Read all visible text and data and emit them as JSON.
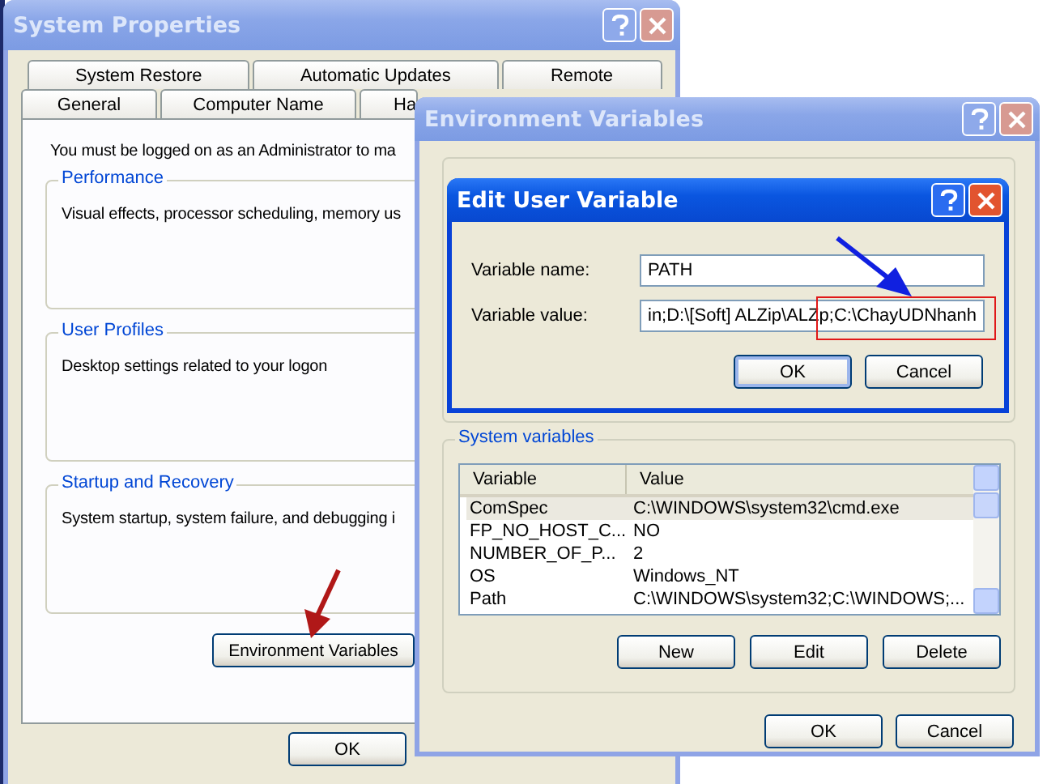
{
  "system_properties": {
    "title": "System Properties",
    "tab_rows": [
      [
        {
          "label": "System Restore"
        },
        {
          "label": "Automatic Updates"
        },
        {
          "label": "Remote"
        }
      ],
      [
        {
          "label": "General"
        },
        {
          "label": "Computer Name"
        },
        {
          "label": "Ha"
        }
      ]
    ],
    "notice": "You must be logged on as an Administrator to ma",
    "groups": [
      {
        "title": "Performance",
        "text": "Visual effects, processor scheduling, memory us"
      },
      {
        "title": "User Profiles",
        "text": "Desktop settings related to your logon"
      },
      {
        "title": "Startup and Recovery",
        "text": "System startup, system failure, and debugging i"
      }
    ],
    "environment_button": "Environment Variables",
    "ok_button": "OK"
  },
  "environment_variables": {
    "title": "Environment Variables",
    "system_variables": {
      "title": "System variables",
      "columns": [
        "Variable",
        "Value"
      ],
      "rows": [
        {
          "variable": "ComSpec",
          "value": "C:\\WINDOWS\\system32\\cmd.exe",
          "selected": true
        },
        {
          "variable": "FP_NO_HOST_C...",
          "value": "NO",
          "selected": false
        },
        {
          "variable": "NUMBER_OF_P...",
          "value": "2",
          "selected": false
        },
        {
          "variable": "OS",
          "value": "Windows_NT",
          "selected": false
        },
        {
          "variable": "Path",
          "value": "C:\\WINDOWS\\system32;C:\\WINDOWS;...",
          "selected": false
        }
      ]
    },
    "list_buttons": [
      "New",
      "Edit",
      "Delete"
    ],
    "dialog_buttons": [
      "OK",
      "Cancel"
    ]
  },
  "edit_user_variable": {
    "title": "Edit User Variable",
    "fields": [
      {
        "label": "Variable name:",
        "value": "PATH"
      },
      {
        "label": "Variable value:",
        "value": "in;D:\\[Soft] ALZip\\ALZp;C:\\ChayUDNhanh"
      }
    ],
    "buttons": [
      "OK",
      "Cancel"
    ]
  }
}
